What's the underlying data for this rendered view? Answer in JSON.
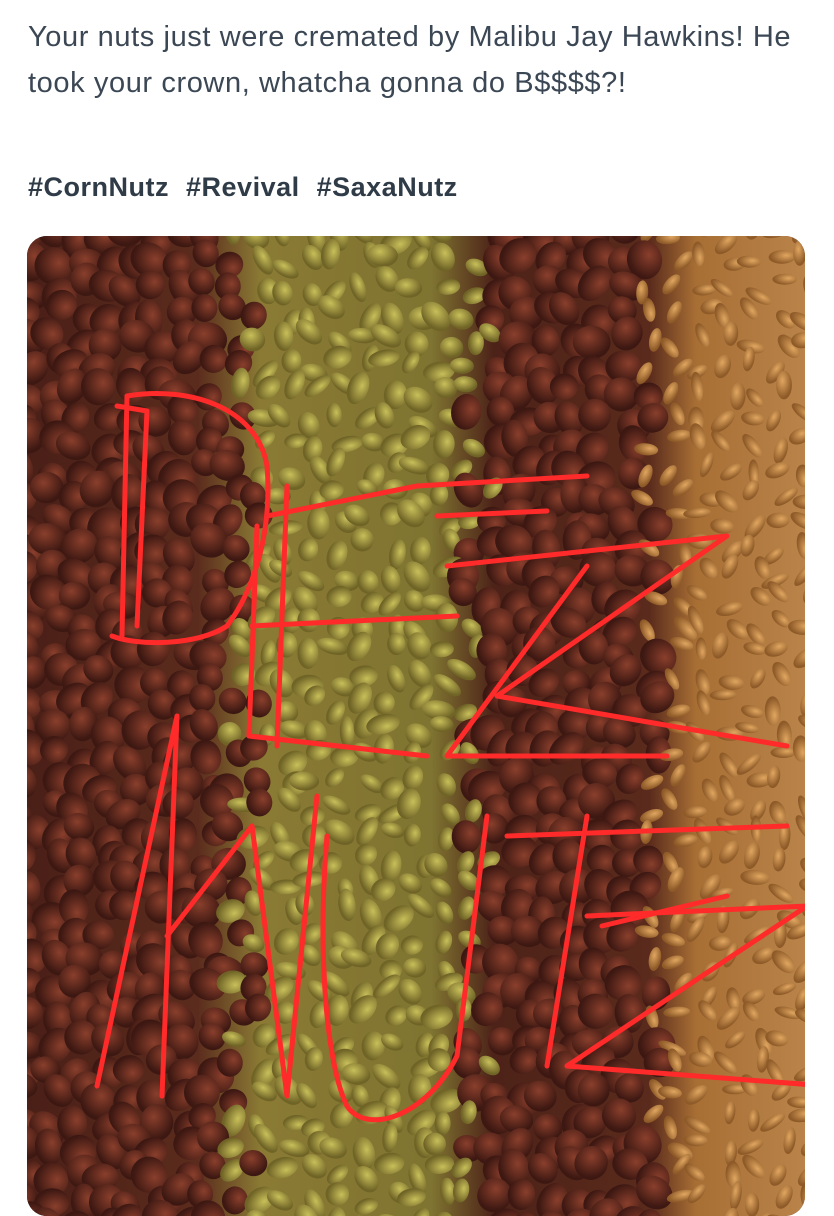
{
  "tweet": {
    "text": "Your nuts just were cremated by Malibu Jay Hawkins! He took your crown, whatcha gonna do B$$$$?!",
    "hashtags": [
      "#CornNutz",
      "#Revival",
      "#SaxaNutz"
    ]
  },
  "media": {
    "description_icon": "photo-image",
    "colors": {
      "hazelnut": "#5b2a1e",
      "pistachio": "#9a8a3a",
      "pine_nut": "#b98346",
      "scribble": "#ff2a2a"
    }
  }
}
